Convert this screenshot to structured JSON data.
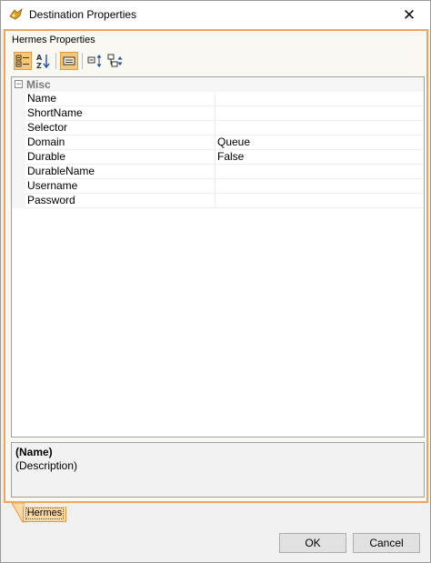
{
  "window": {
    "title": "Destination Properties",
    "close_glyph": "✕"
  },
  "panel": {
    "group_label": "Hermes Properties"
  },
  "toolbar": {
    "buttons": [
      {
        "icon": "categorized-icon",
        "active": true
      },
      {
        "icon": "alphabetical-icon",
        "active": false
      },
      {
        "icon": "property-pages-icon",
        "active": true
      },
      {
        "icon": "expand-all-icon",
        "active": false
      },
      {
        "icon": "collapse-all-icon",
        "active": false
      }
    ]
  },
  "grid": {
    "category": "Misc",
    "properties": [
      {
        "name": "Name",
        "value": ""
      },
      {
        "name": "ShortName",
        "value": ""
      },
      {
        "name": "Selector",
        "value": ""
      },
      {
        "name": "Domain",
        "value": "Queue"
      },
      {
        "name": "Durable",
        "value": "False"
      },
      {
        "name": "DurableName",
        "value": ""
      },
      {
        "name": "Username",
        "value": ""
      },
      {
        "name": "Password",
        "value": ""
      }
    ]
  },
  "description": {
    "title": "(Name)",
    "text": "(Description)"
  },
  "tabs": [
    {
      "label": "Hermes",
      "selected": true
    }
  ],
  "buttons": {
    "ok": "OK",
    "cancel": "Cancel"
  },
  "colors": {
    "accent_border": "#f0a55a",
    "tab_fill": "#fbd9a6",
    "toolbar_active": "#f5c57a"
  }
}
